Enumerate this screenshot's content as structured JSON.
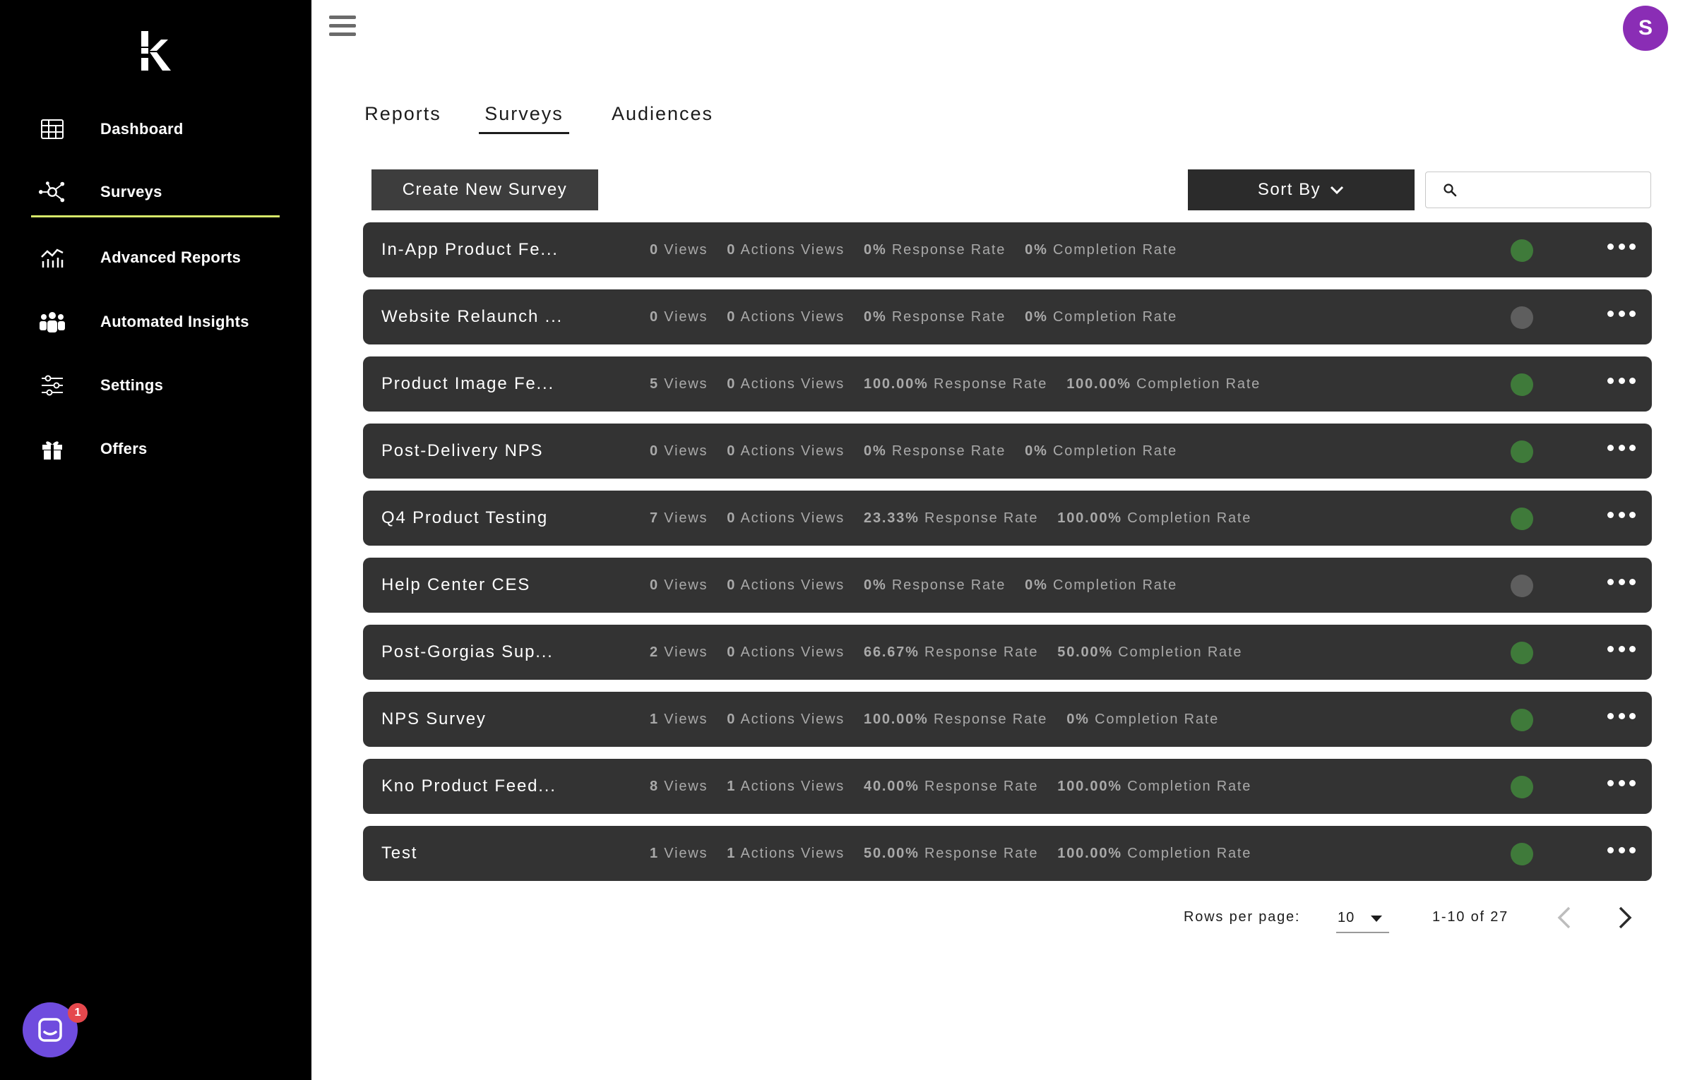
{
  "app": {
    "avatar_letter": "S"
  },
  "sidebar": {
    "items": [
      {
        "label": "Dashboard",
        "icon": "grid-icon"
      },
      {
        "label": "Surveys",
        "icon": "network-icon",
        "active": true
      },
      {
        "label": "Advanced Reports",
        "icon": "chart-icon"
      },
      {
        "label": "Automated Insights",
        "icon": "people-icon"
      },
      {
        "label": "Settings",
        "icon": "sliders-icon"
      },
      {
        "label": "Offers",
        "icon": "gift-icon"
      }
    ],
    "chat_badge": "1",
    "accent_color": "#d7e86a"
  },
  "tabs": [
    {
      "label": "Reports"
    },
    {
      "label": "Surveys",
      "active": true
    },
    {
      "label": "Audiences"
    }
  ],
  "toolbar": {
    "create_label": "Create New Survey",
    "sort_label": "Sort By",
    "search_placeholder": ""
  },
  "stat_labels": {
    "views": "Views",
    "actions_views": "Actions Views",
    "response_rate": "Response Rate",
    "completion_rate": "Completion Rate"
  },
  "surveys": [
    {
      "name": "In-App Product Fe...",
      "views": "0",
      "actions_views": "0",
      "response_rate": "0%",
      "completion_rate": "0%",
      "status": "active"
    },
    {
      "name": "Website Relaunch ...",
      "views": "0",
      "actions_views": "0",
      "response_rate": "0%",
      "completion_rate": "0%",
      "status": "inactive"
    },
    {
      "name": "Product Image Fe...",
      "views": "5",
      "actions_views": "0",
      "response_rate": "100.00%",
      "completion_rate": "100.00%",
      "status": "active"
    },
    {
      "name": "Post-Delivery NPS",
      "views": "0",
      "actions_views": "0",
      "response_rate": "0%",
      "completion_rate": "0%",
      "status": "active"
    },
    {
      "name": "Q4 Product Testing",
      "views": "7",
      "actions_views": "0",
      "response_rate": "23.33%",
      "completion_rate": "100.00%",
      "status": "active"
    },
    {
      "name": "Help Center CES",
      "views": "0",
      "actions_views": "0",
      "response_rate": "0%",
      "completion_rate": "0%",
      "status": "inactive"
    },
    {
      "name": "Post-Gorgias Sup...",
      "views": "2",
      "actions_views": "0",
      "response_rate": "66.67%",
      "completion_rate": "50.00%",
      "status": "active"
    },
    {
      "name": "NPS Survey",
      "views": "1",
      "actions_views": "0",
      "response_rate": "100.00%",
      "completion_rate": "0%",
      "status": "active"
    },
    {
      "name": "Kno Product Feed...",
      "views": "8",
      "actions_views": "1",
      "response_rate": "40.00%",
      "completion_rate": "100.00%",
      "status": "active"
    },
    {
      "name": "Test",
      "views": "1",
      "actions_views": "1",
      "response_rate": "50.00%",
      "completion_rate": "100.00%",
      "status": "active"
    }
  ],
  "status_colors": {
    "active": "#3f7a3a",
    "inactive": "#5e5e5e"
  },
  "pagination": {
    "rows_per_page_label": "Rows per page:",
    "rows_per_page": "10",
    "range": "1-10 of 27"
  }
}
